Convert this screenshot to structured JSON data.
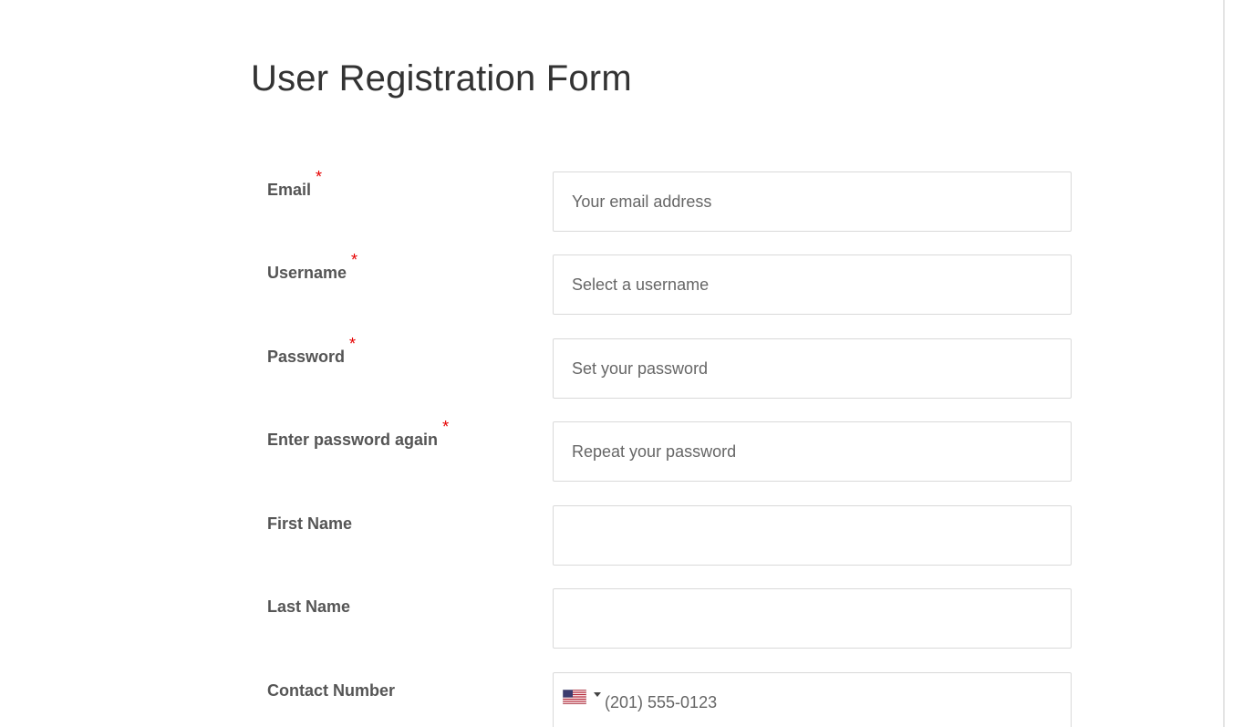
{
  "form": {
    "title": "User Registration Form",
    "required_marker": "*"
  },
  "fields": [
    {
      "label": "Email",
      "placeholder": "Your email address",
      "value": "",
      "required": true
    },
    {
      "label": "Username",
      "placeholder": "Select a username",
      "value": "",
      "required": true
    },
    {
      "label": "Password",
      "placeholder": "Set your password",
      "value": "",
      "required": true
    },
    {
      "label": "Enter password again",
      "placeholder": "Repeat your password",
      "value": "",
      "required": true
    },
    {
      "label": "First Name",
      "placeholder": "",
      "value": "",
      "required": false
    },
    {
      "label": "Last Name",
      "placeholder": "",
      "value": "",
      "required": false
    },
    {
      "label": "Contact Number",
      "placeholder": "(201) 555-0123",
      "value": "",
      "required": false,
      "country_flag": "us-flag-icon"
    }
  ],
  "colors": {
    "required_star": "#e60000",
    "label_text": "#555555",
    "title_text": "#333333",
    "input_border": "#d9d9d9",
    "placeholder_text": "#666666"
  }
}
